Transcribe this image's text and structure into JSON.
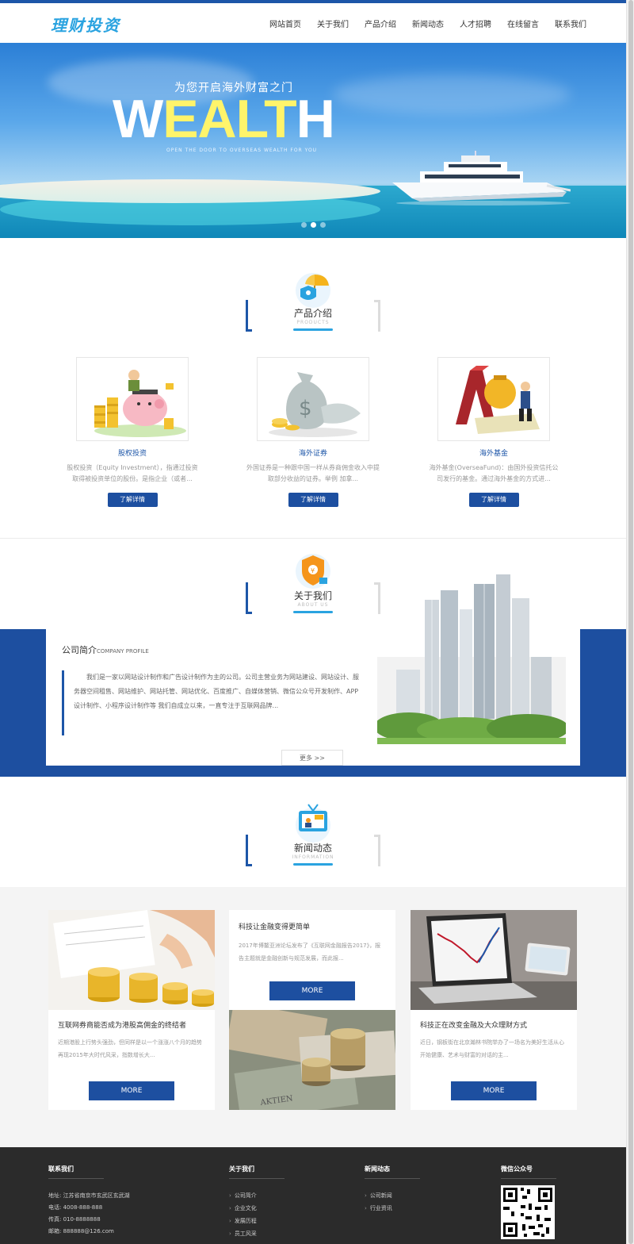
{
  "header": {
    "logo": "理财投资",
    "nav": [
      "网站首页",
      "关于我们",
      "产品介绍",
      "新闻动态",
      "人才招聘",
      "在线留言",
      "联系我们"
    ]
  },
  "banner": {
    "subtitle": "为您开启海外财富之门",
    "headline_w": "W",
    "headline_mid": "EALT",
    "headline_h": "H",
    "tagline": "OPEN THE DOOR TO OVERSEAS WEALTH FOR YOU",
    "slides_total": 3,
    "slide_active": 2
  },
  "products": {
    "title_cn": "产品介绍",
    "title_en": "PRODUCTS",
    "items": [
      {
        "name": "股权投资",
        "desc": "股权投资（Equity Investment），指通过投资取得被投资单位的股份。是指企业（或者...",
        "button": "了解详情"
      },
      {
        "name": "海外证券",
        "desc": "外国证券是一种跟中国一样从券商佣金收入中提取部分收益的证券。举例 加拿...",
        "button": "了解详情"
      },
      {
        "name": "海外基金",
        "desc": "海外基金(OverseaFund)：由国外投资信托公司发行的基金。通过海外基金的方式进...",
        "button": "了解详情"
      }
    ]
  },
  "about": {
    "title_cn": "关于我们",
    "title_en": "ABOUT US",
    "heading_cn": "公司简介",
    "heading_en": "COMPANY PROFILE",
    "text": "我们是一家以网站设计制作和广告设计制作为主的公司。公司主营业务为网站建设、网站设计、服务器空间租售、网站维护、网站托管、网站优化、百度推广、自媒体营销、微信公众号开发制作、APP设计制作、小程序设计制作等 我们自成立以来，一直专注于互联网品牌...",
    "more": "更多 >>"
  },
  "news": {
    "title_cn": "新闻动态",
    "title_en": "INFORMATION",
    "items": [
      {
        "title": "互联网券商能否成为港股高佣金的终结者",
        "desc": "近期港股上行势头强劲，但同样是以一个涨涨八个月的趋势再现2015年大时代风采，指数增长大...",
        "more": "MORE"
      },
      {
        "title": "科技让金融变得更简单",
        "desc": "2017年博鳌亚洲论坛发布了《互联网金融报告2017》，报告主题就是金融创新与规范发展，而此报...",
        "more": "MORE"
      },
      {
        "title": "科技正在改变金融及大众理财方式",
        "desc": "近日，钢板街在北京瀚林书院举办了一场名为美好生活从心开始健康、艺术与财富的对话的主...",
        "more": "MORE"
      }
    ]
  },
  "footer": {
    "contact": {
      "heading": "联系我们",
      "lines": [
        "地址: 江苏省南京市玄武区玄武湖",
        "电话: 4008-888-888",
        "传真: 010-8888888",
        "邮箱: 888888@126.com"
      ]
    },
    "about": {
      "heading": "关于我们",
      "links": [
        "公司简介",
        "企业文化",
        "发展历程",
        "员工风采"
      ]
    },
    "news": {
      "heading": "新闻动态",
      "links": [
        "公司新闻",
        "行业资讯"
      ]
    },
    "wechat": {
      "heading": "微信公众号"
    }
  },
  "colors": {
    "primary": "#1d4fa0",
    "accent_blue": "#2aa3e0",
    "headline_yellow": "#fff46b",
    "footer_bg": "#2b2b2b"
  }
}
